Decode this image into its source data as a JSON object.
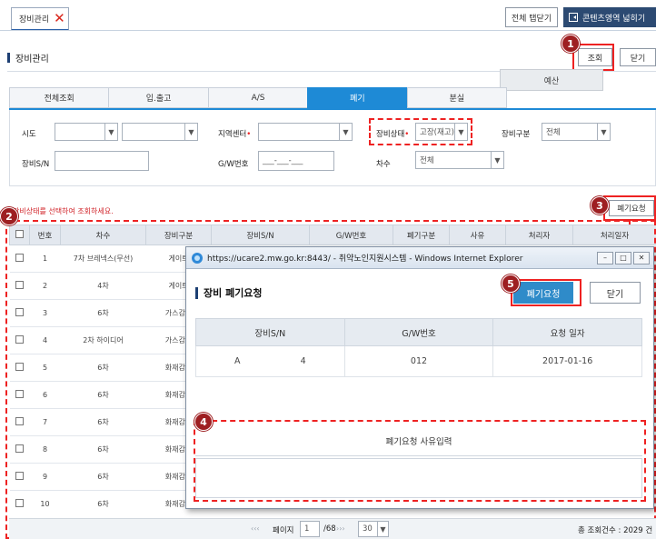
{
  "top_tab": {
    "label": "장비관리"
  },
  "header_buttons": {
    "close_all": "전체 탭닫기",
    "wide_view": "콘텐츠영역 넓히기"
  },
  "page": {
    "title": "장비관리",
    "search_button": "조회",
    "close_button": "닫기",
    "dropdown_tip": "예산"
  },
  "tabs": [
    {
      "label": "전체조회",
      "active": false
    },
    {
      "label": "입.출고",
      "active": false
    },
    {
      "label": "A/S",
      "active": false
    },
    {
      "label": "폐기",
      "active": true
    },
    {
      "label": "분실",
      "active": false
    }
  ],
  "filters": {
    "sido_label": "시도",
    "region_label": "지역센터",
    "status_label": "장비상태",
    "status_value": "고장(재고)",
    "type_label": "장비구분",
    "type_value": "전체",
    "sn_label": "장비S/N",
    "gw_label": "G/W번호",
    "gw_value": "___-___-___",
    "round_label": "차수",
    "round_value": "전체"
  },
  "hint": "장비상태를 선택하여 조회하세요.",
  "dispose_request_button": "폐기요청",
  "grid": {
    "headers": [
      "번호",
      "차수",
      "장비구분",
      "장비S/N",
      "G/W번호",
      "폐기구분",
      "사유",
      "처리자",
      "처리일자"
    ],
    "rows": [
      {
        "no": "1",
        "round": "7차 브레넥스(무선)",
        "type": "게이트"
      },
      {
        "no": "2",
        "round": "4차",
        "type": "게이트"
      },
      {
        "no": "3",
        "round": "6차",
        "type": "가스감지"
      },
      {
        "no": "4",
        "round": "2차 하이디어",
        "type": "가스감지"
      },
      {
        "no": "5",
        "round": "6차",
        "type": "화재감지"
      },
      {
        "no": "6",
        "round": "6차",
        "type": "화재감지"
      },
      {
        "no": "7",
        "round": "6차",
        "type": "화재감지"
      },
      {
        "no": "8",
        "round": "6차",
        "type": "화재감지"
      },
      {
        "no": "9",
        "round": "6차",
        "type": "화재감지"
      },
      {
        "no": "10",
        "round": "6차",
        "type": "화재감지"
      }
    ]
  },
  "pager": {
    "label": "페이지",
    "page": "1",
    "total_pages": "/68",
    "page_size": "30",
    "total_text": "총 조회건수 : 2029 건"
  },
  "popup": {
    "window_title": "https://ucare2.mw.go.kr:8443/ - 취약노인지원시스템 - Windows Internet Explorer",
    "heading": "장비 폐기요청",
    "request_button": "폐기요청",
    "close_button": "닫기",
    "table_headers": [
      "장비S/N",
      "G/W번호",
      "요청 일자"
    ],
    "row": {
      "sn_a": "A",
      "sn_b": "4",
      "gw": "012",
      "date": "2017-01-16"
    },
    "reason_label": "폐기요청 사유입력"
  },
  "badges": [
    "1",
    "2",
    "3",
    "4",
    "5"
  ],
  "colors": {
    "accent": "#1e8ad6",
    "annotation": "#ee2222",
    "badge": "#9e1f22",
    "nav_dark": "#2c4a72"
  }
}
